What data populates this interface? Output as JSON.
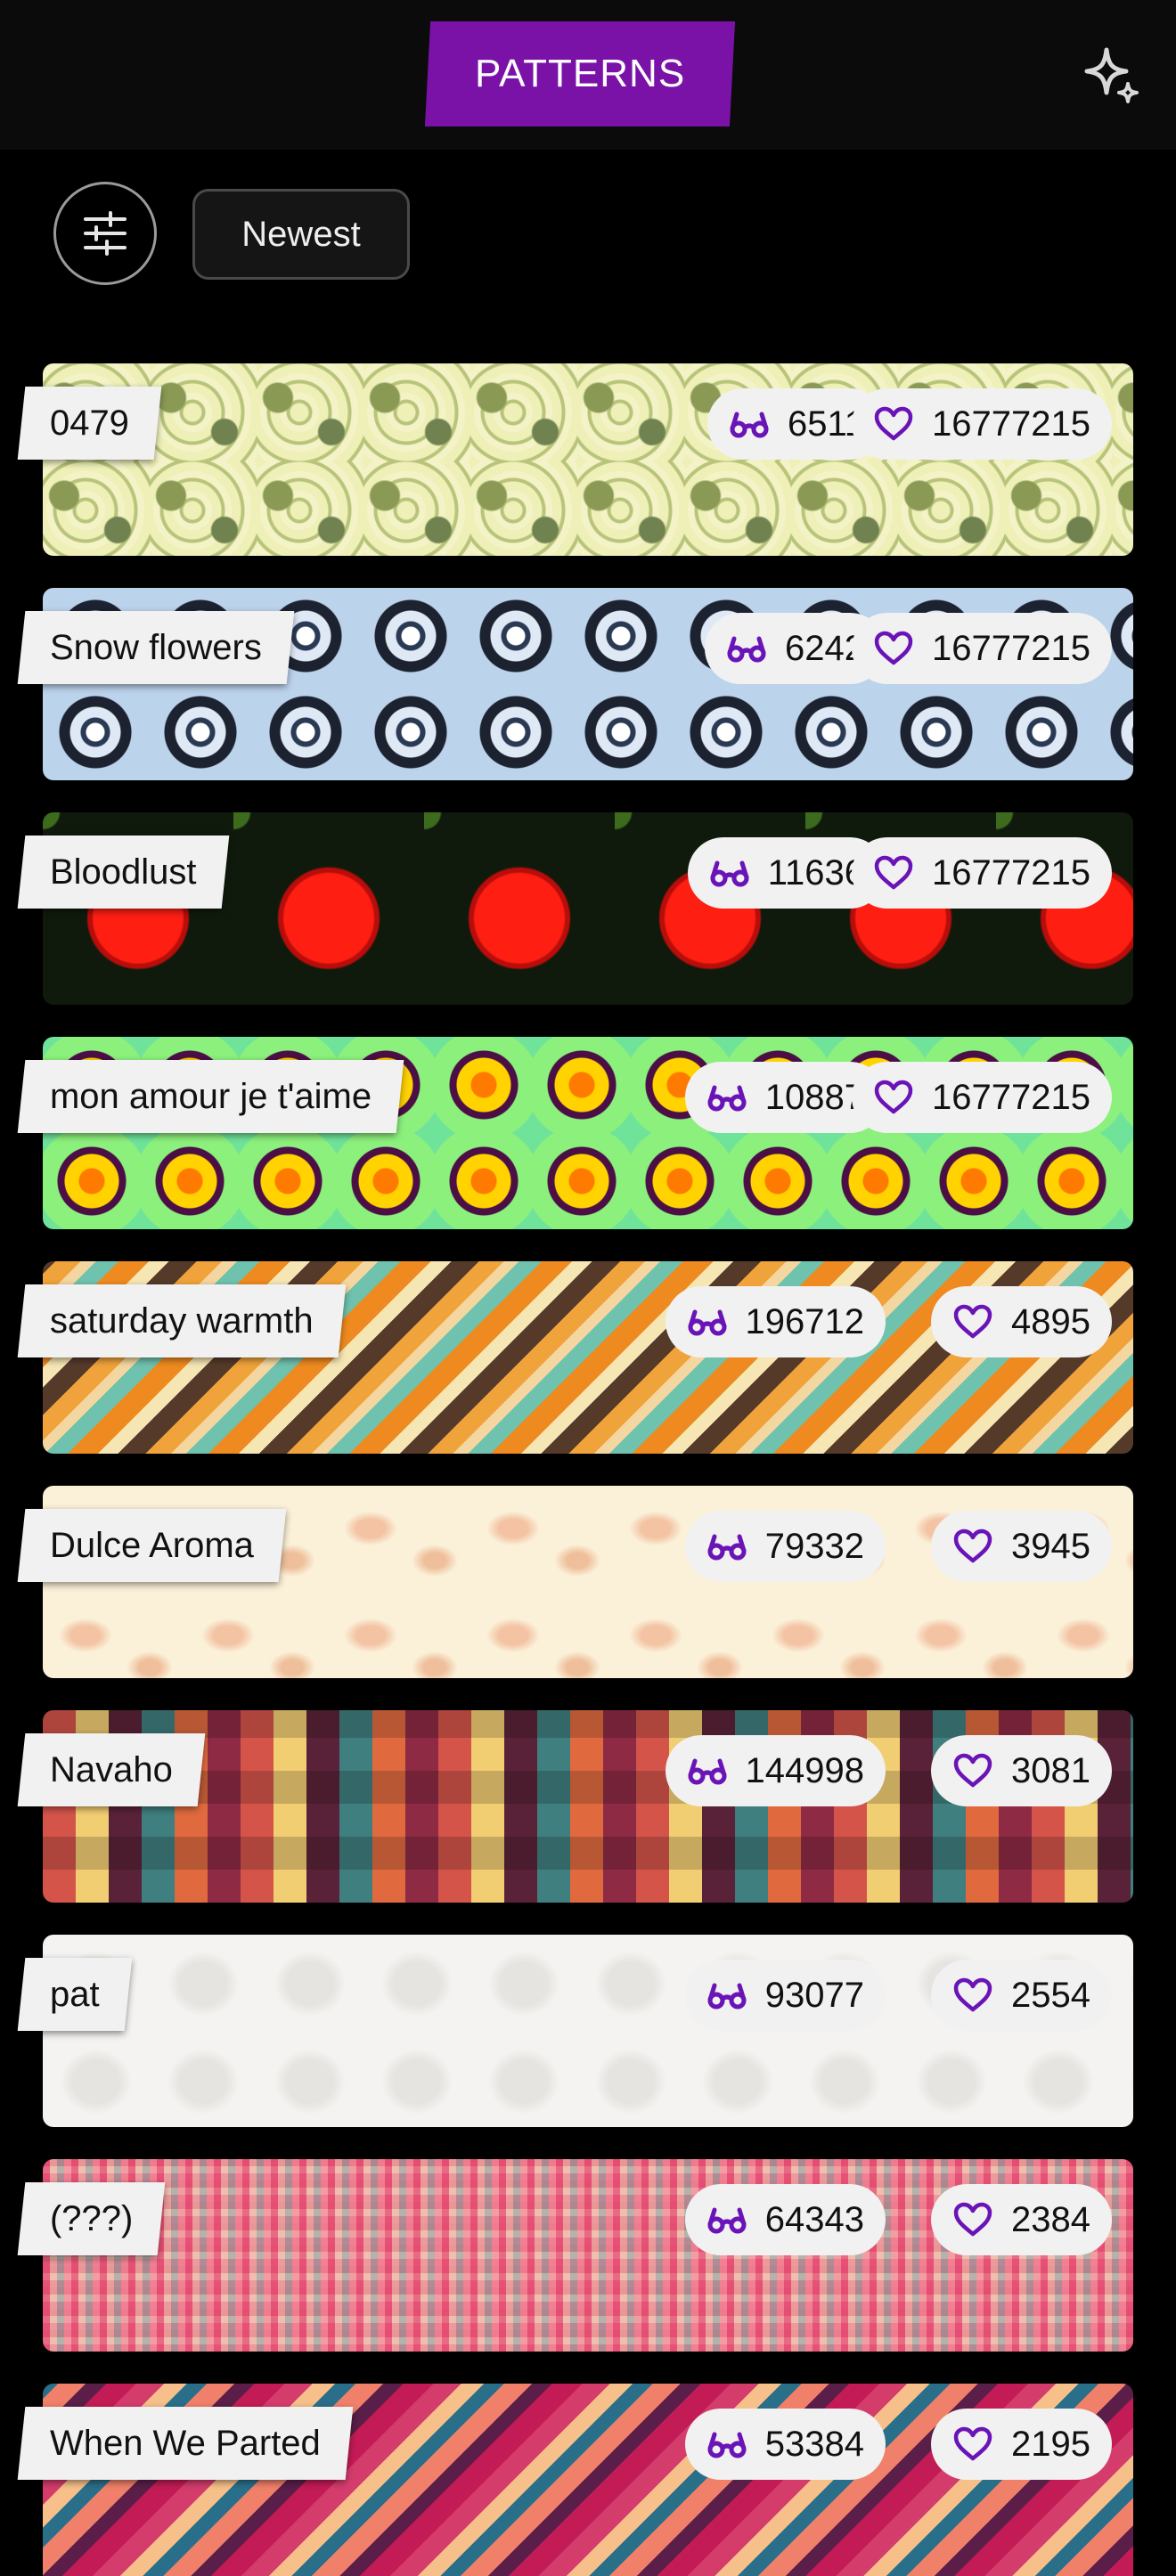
{
  "header": {
    "title": "PATTERNS",
    "sparkle_icon": "sparkle-icon"
  },
  "toolbar": {
    "filter_icon": "sliders-icon",
    "sort_label": "Newest"
  },
  "colors": {
    "accent": "#7a12a8",
    "icon": "#6a14b8",
    "pill": "#f1f1f1",
    "background": "#000000"
  },
  "patterns": [
    {
      "name": "0479",
      "views": "6511",
      "likes": "16777215"
    },
    {
      "name": "Snow flowers",
      "views": "6242",
      "likes": "16777215"
    },
    {
      "name": "Bloodlust",
      "views": "11636",
      "likes": "16777215"
    },
    {
      "name": "mon amour je t'aime",
      "views": "10887",
      "likes": "16777215"
    },
    {
      "name": "saturday warmth",
      "views": "196712",
      "likes": "4895"
    },
    {
      "name": "Dulce Aroma",
      "views": "79332",
      "likes": "3945"
    },
    {
      "name": "Navaho",
      "views": "144998",
      "likes": "3081"
    },
    {
      "name": "pat",
      "views": "93077",
      "likes": "2554"
    },
    {
      "name": "(???)",
      "views": "64343",
      "likes": "2384"
    },
    {
      "name": "When We Parted",
      "views": "53384",
      "likes": "2195"
    }
  ]
}
